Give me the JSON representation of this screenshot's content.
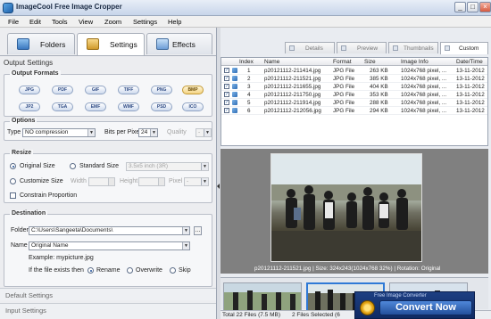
{
  "window": {
    "title": "ImageCool Free Image Cropper",
    "minimize": "_",
    "maximize": "□",
    "close": "×"
  },
  "menu": [
    "File",
    "Edit",
    "Tools",
    "View",
    "Zoom",
    "Settings",
    "Help"
  ],
  "tabs": {
    "folders": "Folders",
    "settings": "Settings",
    "effects": "Effects"
  },
  "left": {
    "output_settings": "Output Settings",
    "output_formats": {
      "title": "Output Formats",
      "formats": [
        "JPG",
        "PDF",
        "GIF",
        "TIFF",
        "PNG",
        "BMP",
        "JP2",
        "TGA",
        "EMF",
        "WMF",
        "PSD",
        "ICO"
      ],
      "selected": "BMP"
    },
    "options": {
      "title": "Options",
      "type_label": "Type",
      "type_value": "NO compression",
      "bpp_label": "Bits per Pixel",
      "bpp_value": "24",
      "quality_label": "Quality",
      "quality_value": "-"
    },
    "resize": {
      "title": "Resize",
      "original_size": "Original Size",
      "standard_size": "Standard Size",
      "standard_value": "3.5x5 inch (3R)",
      "customize_size": "Customize Size",
      "width_label": "Width",
      "height_label": "Height",
      "pixel_label": "Pixel",
      "pixel_value": "-",
      "constrain": "Constrain Proportion"
    },
    "destination": {
      "title": "Destination",
      "folder_label": "Folder",
      "folder_value": "C:\\Users\\Sangeeta\\Documents\\",
      "name_label": "Name",
      "name_value": "Original Name",
      "example": "Example: mypicture.jpg",
      "exists_label": "If the file exists then",
      "rename": "Rename",
      "overwrite": "Overwrite",
      "skip": "Skip"
    },
    "default_settings": "Default Settings",
    "input_settings": "Input Settings"
  },
  "view_tabs": [
    "Details",
    "Preview",
    "Thumbnails",
    "Custom"
  ],
  "file_table": {
    "columns": [
      "Index",
      "Name",
      "Format",
      "Size",
      "Image Info",
      "Date/Time"
    ],
    "rows": [
      {
        "index": "1",
        "name": "p20121112-211414.jpg",
        "format": "JPG File",
        "size": "263 KB",
        "info": "1024x768 pixel, ...",
        "date": "13-11-2012"
      },
      {
        "index": "2",
        "name": "p20121112-211521.jpg",
        "format": "JPG File",
        "size": "385 KB",
        "info": "1024x768 pixel, ...",
        "date": "13-11-2012"
      },
      {
        "index": "3",
        "name": "p20121112-211655.jpg",
        "format": "JPG File",
        "size": "404 KB",
        "info": "1024x768 pixel, ...",
        "date": "13-11-2012"
      },
      {
        "index": "4",
        "name": "p20121112-211750.jpg",
        "format": "JPG File",
        "size": "353 KB",
        "info": "1024x768 pixel, ...",
        "date": "13-11-2012"
      },
      {
        "index": "5",
        "name": "p20121112-211914.jpg",
        "format": "JPG File",
        "size": "288 KB",
        "info": "1024x768 pixel, ...",
        "date": "13-11-2012"
      },
      {
        "index": "6",
        "name": "p20121112-212056.jpg",
        "format": "JPG File",
        "size": "294 KB",
        "info": "1024x768 pixel, ...",
        "date": "13-11-2012"
      }
    ]
  },
  "preview": {
    "caption": "p20121112-211521.jpg  |  Size: 324x243(1024x768 32%)  |  Rotation: Original"
  },
  "status": {
    "total": "Total 22 Files (7.5 MB)",
    "selected": "2 Files Selected (6"
  },
  "promo": {
    "small": "Free Image Converter",
    "cta": "Convert Now"
  }
}
